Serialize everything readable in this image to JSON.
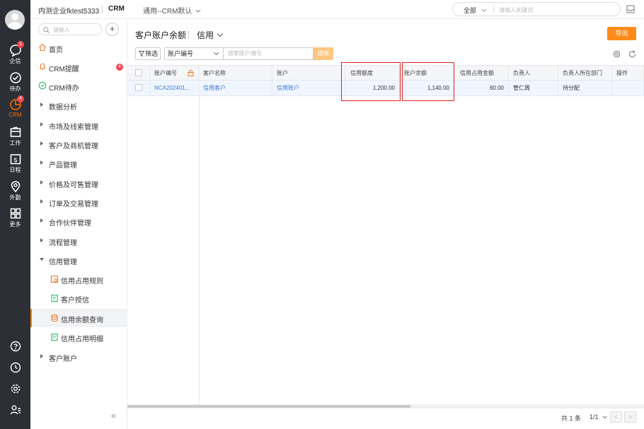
{
  "topbar": {
    "company": "内测企业fktest5333",
    "app": "CRM",
    "scope": "通用--CRM默认",
    "search_scope": "全部",
    "search_placeholder": "请输入关键词"
  },
  "rail": {
    "items": [
      {
        "label": "企信",
        "badge": "1"
      },
      {
        "label": "待办",
        "badge": ""
      },
      {
        "label": "CRM",
        "badge": "4"
      },
      {
        "label": "工作",
        "badge": ""
      },
      {
        "label": "日程",
        "badge": "",
        "day": "5"
      },
      {
        "label": "外勤",
        "badge": ""
      },
      {
        "label": "更多",
        "badge": ""
      }
    ]
  },
  "sidebar": {
    "search_placeholder": "请输入",
    "plus": "+",
    "items": [
      {
        "label": "首页"
      },
      {
        "label": "CRM提醒",
        "badge": "4"
      },
      {
        "label": "CRM待办"
      },
      {
        "label": "数据分析"
      },
      {
        "label": "市场及线索管理"
      },
      {
        "label": "客户及商机管理"
      },
      {
        "label": "产品管理"
      },
      {
        "label": "价格及可售管理"
      },
      {
        "label": "订单及交易管理"
      },
      {
        "label": "合作伙伴管理"
      },
      {
        "label": "流程管理"
      },
      {
        "label": "信用管理"
      },
      {
        "label": "信用占用规则"
      },
      {
        "label": "客户授信"
      },
      {
        "label": "信用余额查询"
      },
      {
        "label": "信用占用明细"
      },
      {
        "label": "客户账户"
      }
    ],
    "collapse": "«"
  },
  "main": {
    "title": "客户账户余额",
    "view": "信用",
    "export_label": "导出",
    "filter_label": "筛选",
    "field_select": "账户编号",
    "search_placeholder": "搜索账户编号",
    "search_button": "搜索"
  },
  "table": {
    "columns": [
      "账户编号",
      "客户名称",
      "账户",
      "信用额度",
      "账户余额",
      "信用占用金额",
      "负责人",
      "负责人所在部门",
      "操作"
    ],
    "rows": [
      {
        "account_no": "NCA202401...",
        "customer": "信用客户",
        "account": "信用账户",
        "credit_limit": "1,200.00",
        "balance": "1,140.00",
        "occupied": "60.00",
        "owner": "管仁周",
        "dept": "待分配",
        "action": ""
      }
    ]
  },
  "pager": {
    "total": "共 1 条",
    "page": "1/1",
    "prev": "<",
    "next": ">"
  },
  "colors": {
    "accent": "#ff8c1a",
    "link": "#3d7bd9",
    "highlight": "#e02020",
    "rail_bg": "#2c2f36"
  }
}
